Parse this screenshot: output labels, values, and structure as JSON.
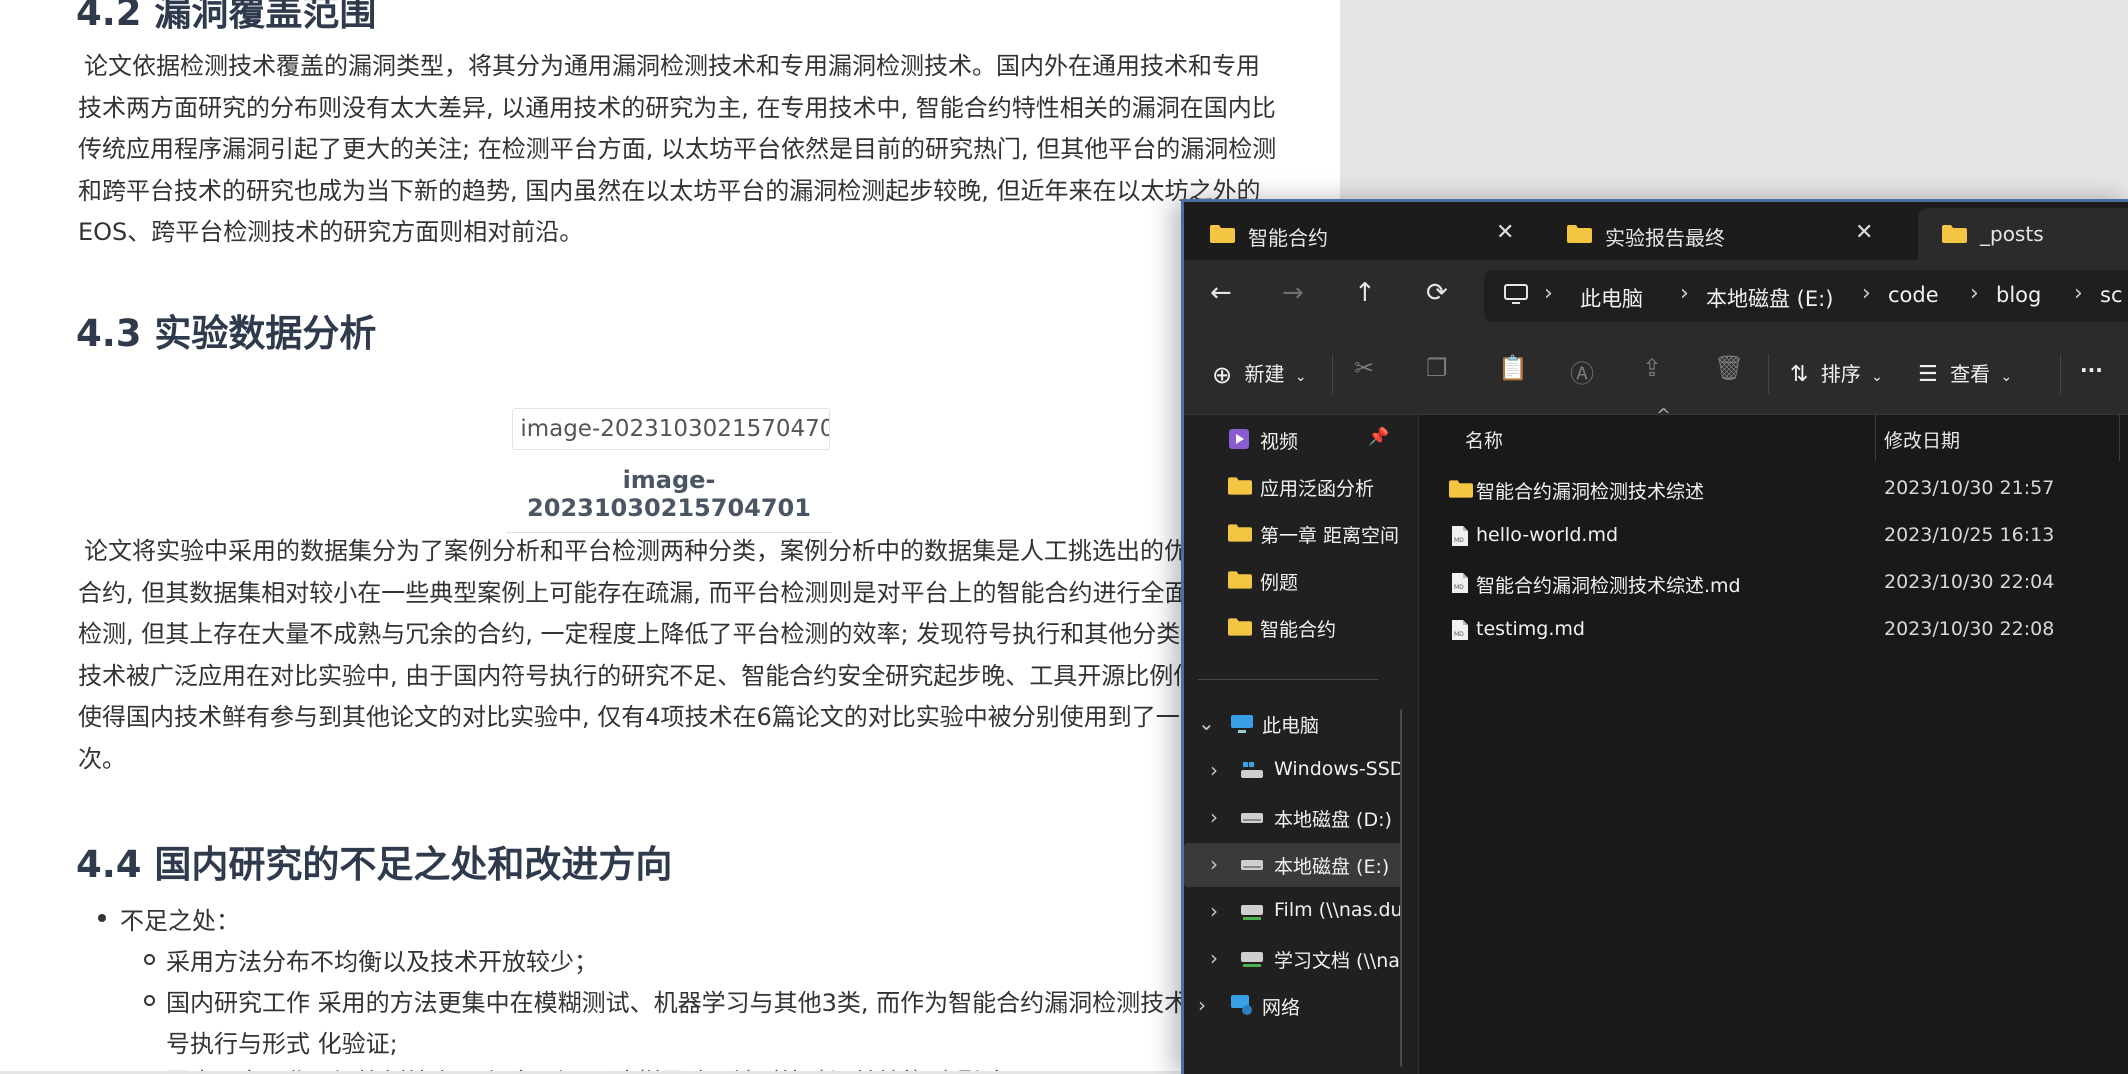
{
  "doc": {
    "h42": "4.2 漏洞覆盖范围",
    "para1": [
      "论文依据检测技术覆盖的漏洞类型，将其分为通用漏洞检测技术和专用漏洞检测技术。国内外在通用技术和专用",
      "技术两方面研究的分布则没有太大差异, 以通用技术的研究为主, 在专用技术中, 智能合约特性相关的漏洞在国内比",
      "传统应用程序漏洞引起了更大的关注; 在检测平台方面, 以太坊平台依然是目前的研究热门, 但其他平台的漏洞检测",
      "和跨平台技术的研究也成为当下新的趋势, 国内虽然在以太坊平台的漏洞检测起步较晚, 但近年来在以太坊之外的",
      "EOS、跨平台检测技术的研究方面则相对前沿。"
    ],
    "h43": "4.3 实验数据分析",
    "image_alt": "image-20231030215704701",
    "image_caption": "image-20231030215704701",
    "para2": [
      "论文将实验中采用的数据集分为了案例分析和平台检测两种分类，案例分析中的数据集是人工挑选出的优质",
      "合约, 但其数据集相对较小在一些典型案例上可能存在疏漏, 而平台检测则是对平台上的智能合约进行全面性",
      "检测, 但其上存在大量不成熟与冗余的合约, 一定程度上降低了平台检测的效率; 发现符号执行和其他分类标",
      "技术被广泛应用在对比实验中, 由于国内符号执行的研究不足、智能合约安全研究起步晚、工具开源比例低等",
      "使得国内技术鲜有参与到其他论文的对比实验中, 仅有4项技术在6篇论文的对比实验中被分别使用到了一次",
      "次。"
    ],
    "h44": "4.4 国内研究的不足之处和改进方向",
    "bullet1": "不足之处：",
    "sub1": "采用方法分布不均衡以及技术开放较少；",
    "sub2_line1": "国内研究工作 采用的方法更集中在模糊测试、机器学习与其他3类, 而作为智能合约漏洞检测技术主流方",
    "sub2_line2": "号执行与形式 化验证;",
    "sub3_partial": "国内研究工作开源比例较小 更倾向于源码 这样导致无法对比验证其效能 也影响"
  },
  "explorer": {
    "tabs": [
      {
        "label": "智能合约",
        "icon": "folder-icon"
      },
      {
        "label": "实验报告最终",
        "icon": "folder-icon"
      },
      {
        "label": "_posts",
        "icon": "folder-icon"
      }
    ],
    "breadcrumbs": [
      "此电脑",
      "本地磁盘 (E:)",
      "code",
      "blog",
      "sc"
    ],
    "toolbar": {
      "new_label": "新建",
      "sort_label": "排序",
      "view_label": "查看",
      "more_label": "···"
    },
    "nav": {
      "quick": [
        {
          "label": "视频",
          "icon": "video-icon",
          "pinned": true
        },
        {
          "label": "应用泛函分析",
          "icon": "folder-icon"
        },
        {
          "label": "第一章 距离空间",
          "icon": "folder-icon"
        },
        {
          "label": "例题",
          "icon": "folder-icon"
        },
        {
          "label": "智能合约",
          "icon": "folder-icon"
        }
      ],
      "this_pc": "此电脑",
      "drives": [
        {
          "label": "Windows-SSD",
          "icon": "windows-drive-icon"
        },
        {
          "label": "本地磁盘 (D:)",
          "icon": "drive-icon"
        },
        {
          "label": "本地磁盘 (E:)",
          "icon": "drive-icon",
          "selected": true
        },
        {
          "label": "Film (\\\\nas.du",
          "icon": "network-drive-icon"
        },
        {
          "label": "学习文档 (\\\\na",
          "icon": "network-drive-icon"
        }
      ],
      "network": "网络"
    },
    "columns": {
      "name": "名称",
      "date": "修改日期"
    },
    "files": [
      {
        "name": "智能合约漏洞检测技术综述",
        "date": "2023/10/30 21:57",
        "type": "folder"
      },
      {
        "name": "hello-world.md",
        "date": "2023/10/25 16:13",
        "type": "md"
      },
      {
        "name": "智能合约漏洞检测技术综述.md",
        "date": "2023/10/30 22:04",
        "type": "md"
      },
      {
        "name": "testimg.md",
        "date": "2023/10/30 22:08",
        "type": "md"
      }
    ],
    "colors": {
      "accent": "#4a6fa5",
      "folder": "#f4c542",
      "bg": "#202020"
    }
  }
}
